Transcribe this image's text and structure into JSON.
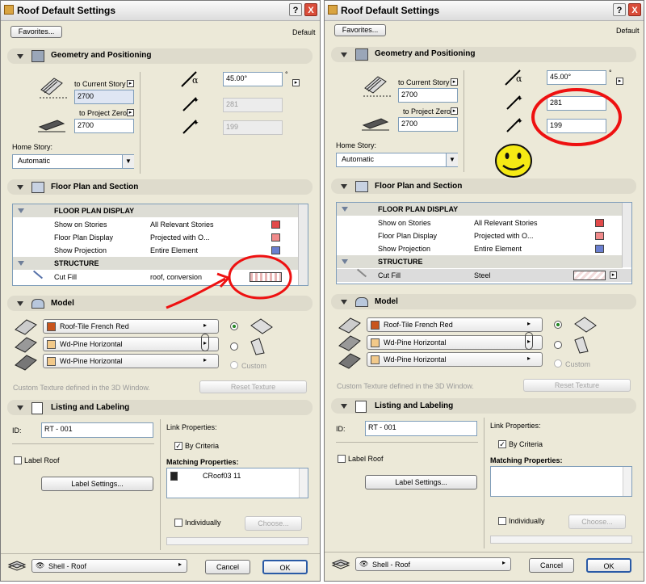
{
  "dialog": {
    "title": "Roof Default Settings",
    "help_label": "?",
    "close_label": "X",
    "favorites_label": "Favorites...",
    "default_label": "Default"
  },
  "geometry": {
    "header": "Geometry and Positioning",
    "to_current_story_label": "to Current Story",
    "to_project_zero_label": "to Project Zero",
    "home_story_label": "Home Story:",
    "home_story_value": "Automatic",
    "degree_unit": "°"
  },
  "floorplan": {
    "header": "Floor Plan and Section",
    "group_display": "FLOOR PLAN DISPLAY",
    "group_structure": "STRUCTURE",
    "show_on_stories_label": "Show on Stories",
    "show_on_stories_value": "All Relevant Stories",
    "floor_plan_display_label": "Floor Plan Display",
    "floor_plan_display_value": "Projected with O...",
    "show_projection_label": "Show Projection",
    "show_projection_value": "Entire Element",
    "cut_fill_label": "Cut Fill"
  },
  "model": {
    "header": "Model",
    "top_material": "Roof-Tile French Red",
    "bottom_material": "Wd-Pine Horizontal",
    "side_material": "Wd-Pine Horizontal",
    "custom_label": "Custom",
    "custom_texture_note": "Custom Texture defined in the 3D Window.",
    "reset_texture_label": "Reset Texture",
    "colors": {
      "roof_tile": "#c8541c",
      "pine": "#f2c98a"
    }
  },
  "listing": {
    "header": "Listing and Labeling",
    "id_label": "ID:",
    "id_value": "RT - 001",
    "label_roof_label": "Label Roof",
    "label_settings_label": "Label Settings...",
    "link_properties_label": "Link Properties:",
    "by_criteria_label": "By Criteria",
    "matching_properties_label": "Matching Properties:",
    "individually_label": "Individually",
    "choose_label": "Choose..."
  },
  "footer": {
    "layer_value": "Shell - Roof",
    "cancel_label": "Cancel",
    "ok_label": "OK"
  },
  "left": {
    "story_value": "2700",
    "zero_value": "2700",
    "pitch_value": "45.00°",
    "height_value": "281",
    "length_value": "199",
    "cut_fill_value": "roof, conversion",
    "matching_item": "CRoof03 11"
  },
  "right": {
    "story_value": "2700",
    "zero_value": "2700",
    "pitch_value": "45.00°",
    "height_value": "281",
    "length_value": "199",
    "cut_fill_value": "Steel"
  },
  "annotations": {
    "red_color": "#ee1111",
    "smiley_color": "#f5ea14"
  }
}
